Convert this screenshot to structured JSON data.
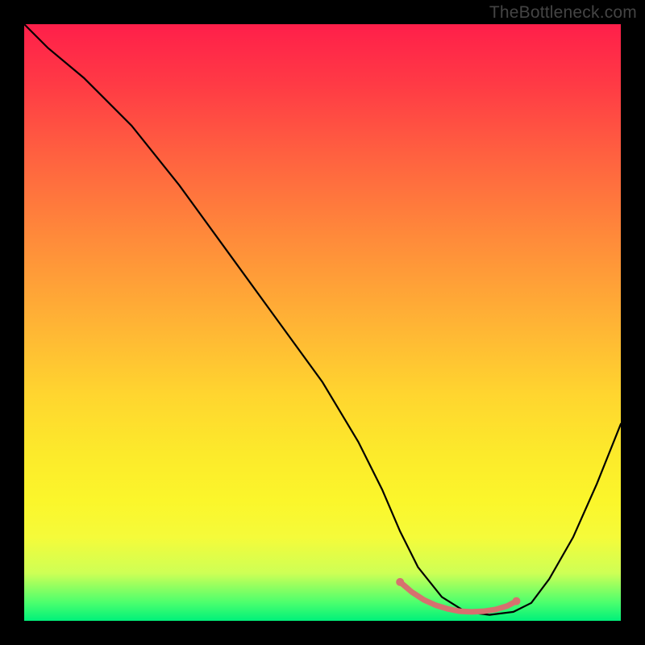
{
  "watermark": "TheBottleneck.com",
  "chart_data": {
    "type": "line",
    "title": "",
    "xlabel": "",
    "ylabel": "",
    "xlim": [
      0,
      100
    ],
    "ylim": [
      0,
      100
    ],
    "series": [
      {
        "name": "bottleneck-curve",
        "x": [
          0,
          4,
          10,
          18,
          26,
          34,
          42,
          50,
          56,
          60,
          63,
          66,
          70,
          74,
          78,
          82,
          85,
          88,
          92,
          96,
          100
        ],
        "values": [
          100,
          96,
          91,
          83,
          73,
          62,
          51,
          40,
          30,
          22,
          15,
          9,
          4,
          1.5,
          1,
          1.5,
          3,
          7,
          14,
          23,
          33
        ]
      }
    ],
    "highlight": {
      "name": "optimal-range-marker",
      "color": "#d6716f",
      "x": [
        63,
        65,
        67,
        69,
        71,
        73,
        75,
        77,
        79,
        81,
        82.5
      ],
      "values": [
        6.5,
        4.8,
        3.5,
        2.6,
        2.0,
        1.6,
        1.5,
        1.6,
        1.9,
        2.5,
        3.3
      ]
    }
  }
}
